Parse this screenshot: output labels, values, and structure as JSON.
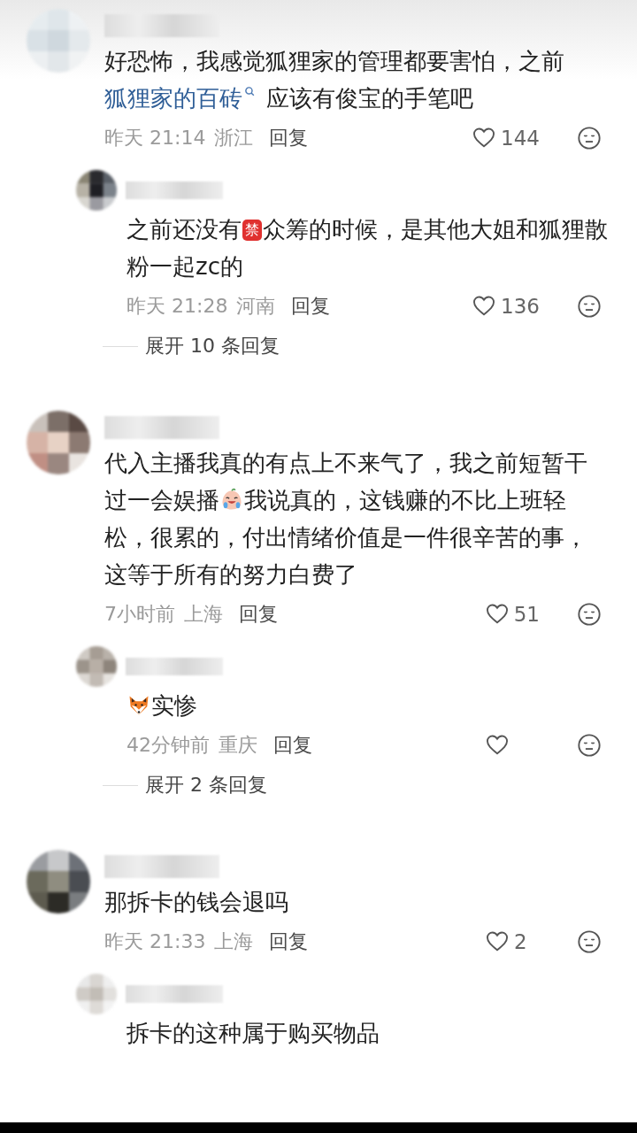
{
  "comments": [
    {
      "text": [
        {
          "kind": "text",
          "text": "好恐怖，我感觉狐狸家的管理都要害怕，之前 "
        },
        {
          "kind": "link",
          "text": "狐狸家的百砖"
        },
        {
          "kind": "text",
          "text": " 应该有俊宝的手笔吧"
        }
      ],
      "time": "昨天 21:14",
      "location": "浙江",
      "reply_label": "回复",
      "likes": "144",
      "replies": [
        {
          "text": [
            {
              "kind": "text",
              "text": "之前还没有"
            },
            {
              "kind": "badge",
              "text": "禁"
            },
            {
              "kind": "text",
              "text": "众筹的时候，是其他大姐和狐狸散粉一起zc的"
            }
          ],
          "time": "昨天 21:28",
          "location": "河南",
          "reply_label": "回复",
          "likes": "136"
        }
      ],
      "expand_label": "展开 10 条回复"
    },
    {
      "text": [
        {
          "kind": "text",
          "text": "代入主播我真的有点上不来气了，我之前短暂干过一会娱播"
        },
        {
          "kind": "crying"
        },
        {
          "kind": "text",
          "text": "我说真的，这钱赚的不比上班轻松，很累的，付出情绪价值是一件很辛苦的事，这等于所有的努力白费了"
        }
      ],
      "time": "7小时前",
      "location": "上海",
      "reply_label": "回复",
      "likes": "51",
      "replies": [
        {
          "text": [
            {
              "kind": "fox"
            },
            {
              "kind": "text",
              "text": "实惨"
            }
          ],
          "time": "42分钟前",
          "location": "重庆",
          "reply_label": "回复"
        }
      ],
      "expand_label": "展开 2 条回复"
    },
    {
      "text": [
        {
          "kind": "text",
          "text": "那拆卡的钱会退吗"
        }
      ],
      "time": "昨天 21:33",
      "location": "上海",
      "reply_label": "回复",
      "likes": "2",
      "replies": [
        {
          "text": [
            {
              "kind": "text",
              "text": "拆卡的这种属于购买物品"
            }
          ]
        }
      ]
    }
  ]
}
